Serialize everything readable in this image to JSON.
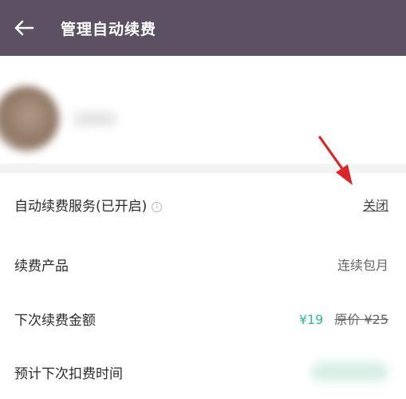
{
  "header": {
    "back_icon": "arrow-left-icon",
    "title": "管理自动续费"
  },
  "rows": {
    "auto_renew": {
      "label": "自动续费服务(已开启)",
      "info_icon": "info-icon",
      "info_glyph": "i",
      "action": "关闭"
    },
    "product": {
      "label": "续费产品",
      "value": "连续包月"
    },
    "next_amount": {
      "label": "下次续费金额",
      "current_price": "¥19",
      "original_price": "原价 ¥25"
    },
    "next_date": {
      "label": "预计下次扣费时间"
    }
  },
  "colors": {
    "header_bg": "#5c5163",
    "price_green": "#2fb89a",
    "annotation_arrow": "#d9262a"
  }
}
